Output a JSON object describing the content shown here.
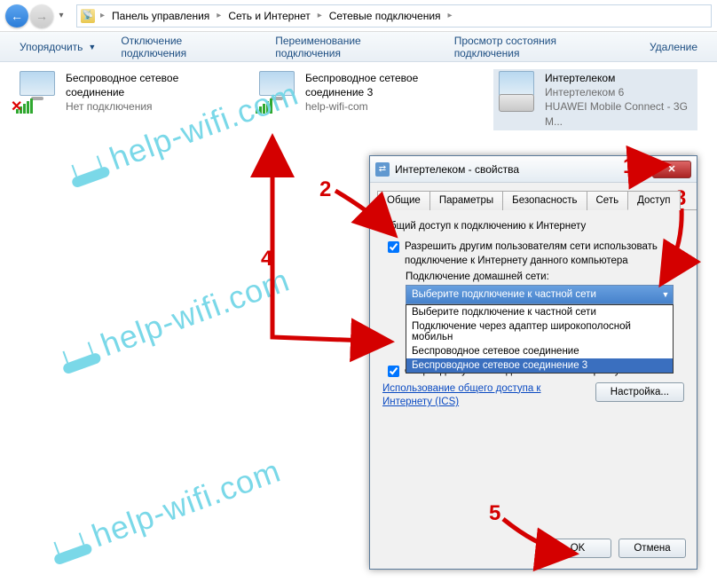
{
  "colors": {
    "accent_red": "#d40000",
    "watermark": "#73d6e7"
  },
  "nav": {
    "back_icon": "←",
    "fwd_icon": "→",
    "dd_icon": "▾",
    "breadcrumb": {
      "icon_glyph": "📡",
      "items": [
        "Панель управления",
        "Сеть и Интернет",
        "Сетевые подключения"
      ]
    }
  },
  "toolbar": {
    "organize": "Упорядочить",
    "disable": "Отключение подключения",
    "rename": "Переименование подключения",
    "view_status": "Просмотр состояния подключения",
    "delete": "Удаление"
  },
  "connections": [
    {
      "name": "Беспроводное сетевое соединение",
      "status": "Нет подключения",
      "sub2": "",
      "has_x": true,
      "has_modem": false
    },
    {
      "name": "Беспроводное сетевое соединение 3",
      "status": "",
      "sub2": "help-wifi-com",
      "has_x": false,
      "has_modem": false
    },
    {
      "name": "Интертелеком",
      "status": "Интертелеком 6",
      "sub2": "HUAWEI Mobile Connect - 3G M...",
      "has_x": false,
      "has_modem": true
    }
  ],
  "dialog": {
    "title": "Интертелеком - свойства",
    "close_glyph": "✕",
    "tabs": [
      "Общие",
      "Параметры",
      "Безопасность",
      "Сеть",
      "Доступ"
    ],
    "active_tab": 4,
    "section_title": "Общий доступ к подключению к Интернету",
    "check1": "Разрешить другим пользователям сети использовать подключение к Интернету данного компьютера",
    "home_net_label": "Подключение домашней сети:",
    "combo_selected": "Выберите подключение к частной сети",
    "combo_options": [
      "Выберите подключение к частной сети",
      "Подключение через адаптер широкополосной мобильн",
      "Беспроводное сетевое соединение",
      "Беспроводное сетевое соединение 3"
    ],
    "combo_highlight": 3,
    "check2_partial": "общим доступом к подключению к Интернету",
    "link": "Использование общего доступа к Интернету (ICS)",
    "settings_btn": "Настройка...",
    "ok": "OK",
    "cancel": "Отмена"
  },
  "watermark_text": "help-wifi.com",
  "annotations": {
    "n1": "1",
    "n2": "2",
    "n3": "3",
    "n4": "4",
    "n5": "5"
  }
}
